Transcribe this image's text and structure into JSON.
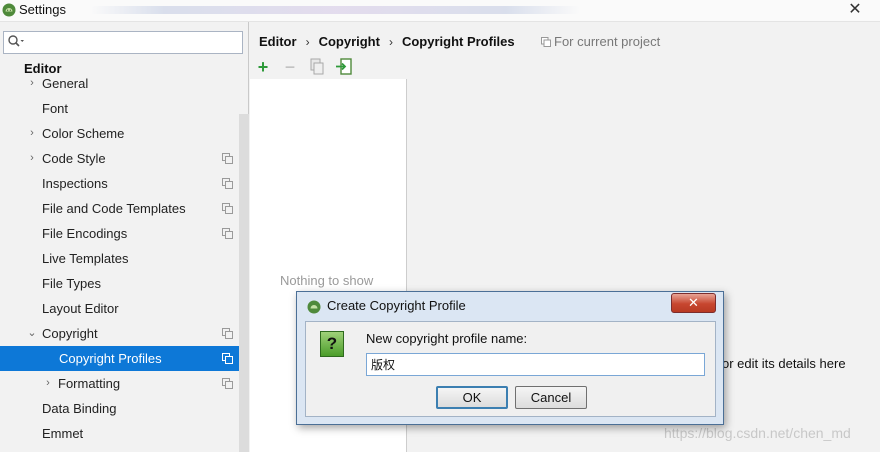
{
  "window": {
    "title": "Settings",
    "close_glyph": "✕"
  },
  "sidebar": {
    "search": {
      "value": "",
      "placeholder": ""
    },
    "section_label": "Editor",
    "items": [
      {
        "label": "General",
        "expanded": false,
        "has_arrow": true,
        "project_scoped": false
      },
      {
        "label": "Font",
        "has_arrow": false,
        "project_scoped": false
      },
      {
        "label": "Color Scheme",
        "expanded": false,
        "has_arrow": true,
        "project_scoped": false
      },
      {
        "label": "Code Style",
        "expanded": false,
        "has_arrow": true,
        "project_scoped": true
      },
      {
        "label": "Inspections",
        "has_arrow": false,
        "project_scoped": true
      },
      {
        "label": "File and Code Templates",
        "has_arrow": false,
        "project_scoped": true
      },
      {
        "label": "File Encodings",
        "has_arrow": false,
        "project_scoped": true
      },
      {
        "label": "Live Templates",
        "has_arrow": false,
        "project_scoped": false
      },
      {
        "label": "File Types",
        "has_arrow": false,
        "project_scoped": false
      },
      {
        "label": "Layout Editor",
        "has_arrow": false,
        "project_scoped": false
      },
      {
        "label": "Copyright",
        "expanded": true,
        "has_arrow": true,
        "project_scoped": true
      },
      {
        "label": "Copyright Profiles",
        "has_arrow": false,
        "project_scoped": true,
        "selected": true
      },
      {
        "label": "Formatting",
        "expanded": false,
        "has_arrow": true,
        "project_scoped": true
      },
      {
        "label": "Data Binding",
        "has_arrow": false,
        "project_scoped": false
      },
      {
        "label": "Emmet",
        "has_arrow": false,
        "project_scoped": false
      }
    ]
  },
  "breadcrumb": {
    "items": [
      "Editor",
      "Copyright",
      "Copyright Profiles"
    ],
    "separator": "›",
    "scope_note": "For current project"
  },
  "toolbar": {
    "add_glyph": "+",
    "remove_glyph": "−"
  },
  "profiles_list": {
    "empty_text": "Nothing to show"
  },
  "details_panel": {
    "hint_text": "or edit its details here"
  },
  "watermark": "https://blog.csdn.net/chen_md",
  "dialog": {
    "title": "Create Copyright Profile",
    "close_glyph": "✕",
    "question_glyph": "?",
    "prompt": "New copyright profile name:",
    "input_value": "版权",
    "ok_label": "OK",
    "cancel_label": "Cancel"
  },
  "colors": {
    "selection": "#0d78d7",
    "add_green": "#2e9a3a",
    "android_green": "#7cb342",
    "dialog_close_red": "#c7462f"
  }
}
